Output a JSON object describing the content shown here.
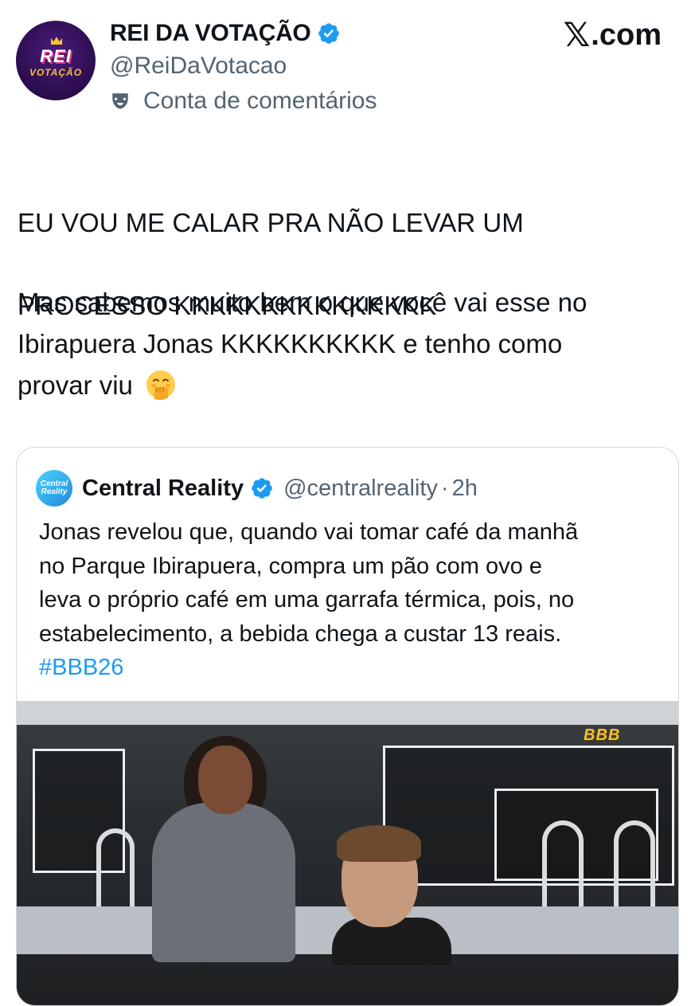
{
  "author": {
    "display_name": "REI DA VOTAÇÃO",
    "handle": "@ReiDaVotacao",
    "account_label": "Conta de comentários",
    "avatar_text_top": "REI",
    "avatar_text_bottom": "VOTAÇÃO"
  },
  "site": {
    "logo": "𝕏",
    "domain": ".com"
  },
  "post": {
    "paragraph1_line1": "EU VOU ME CALAR PRA NÃO LEVAR UM",
    "paragraph1_line2": "PROCESSO KKKKKKKKKKKKKKK",
    "paragraph2_line1": "Mas sabemos muito bem o que você vai esse no",
    "paragraph2_line2": "Ibirapuera Jonas KKKKKKKKKK e tenho como",
    "paragraph2_line3": "provar viu",
    "emoji_name": "hand-over-mouth-emoji"
  },
  "quoted_post": {
    "avatar_text": "Central Reality",
    "display_name": "Central Reality",
    "handle": "@centralreality",
    "separator": "·",
    "time": "2h",
    "text_line1": "Jonas revelou que, quando vai tomar café da manhã",
    "text_line2": "no Parque Ibirapuera, compra um pão com ovo e",
    "text_line3": "leva o próprio café em uma garrafa térmica, pois, no",
    "text_line4": "estabelecimento, a bebida chega a custar 13 reais.",
    "hashtag": "#BBB26",
    "image_watermark": "BBB"
  },
  "colors": {
    "verified_blue": "#1d9bf0",
    "secondary_text": "#536471",
    "primary_text": "#0f1419",
    "border": "#cfd9de"
  }
}
